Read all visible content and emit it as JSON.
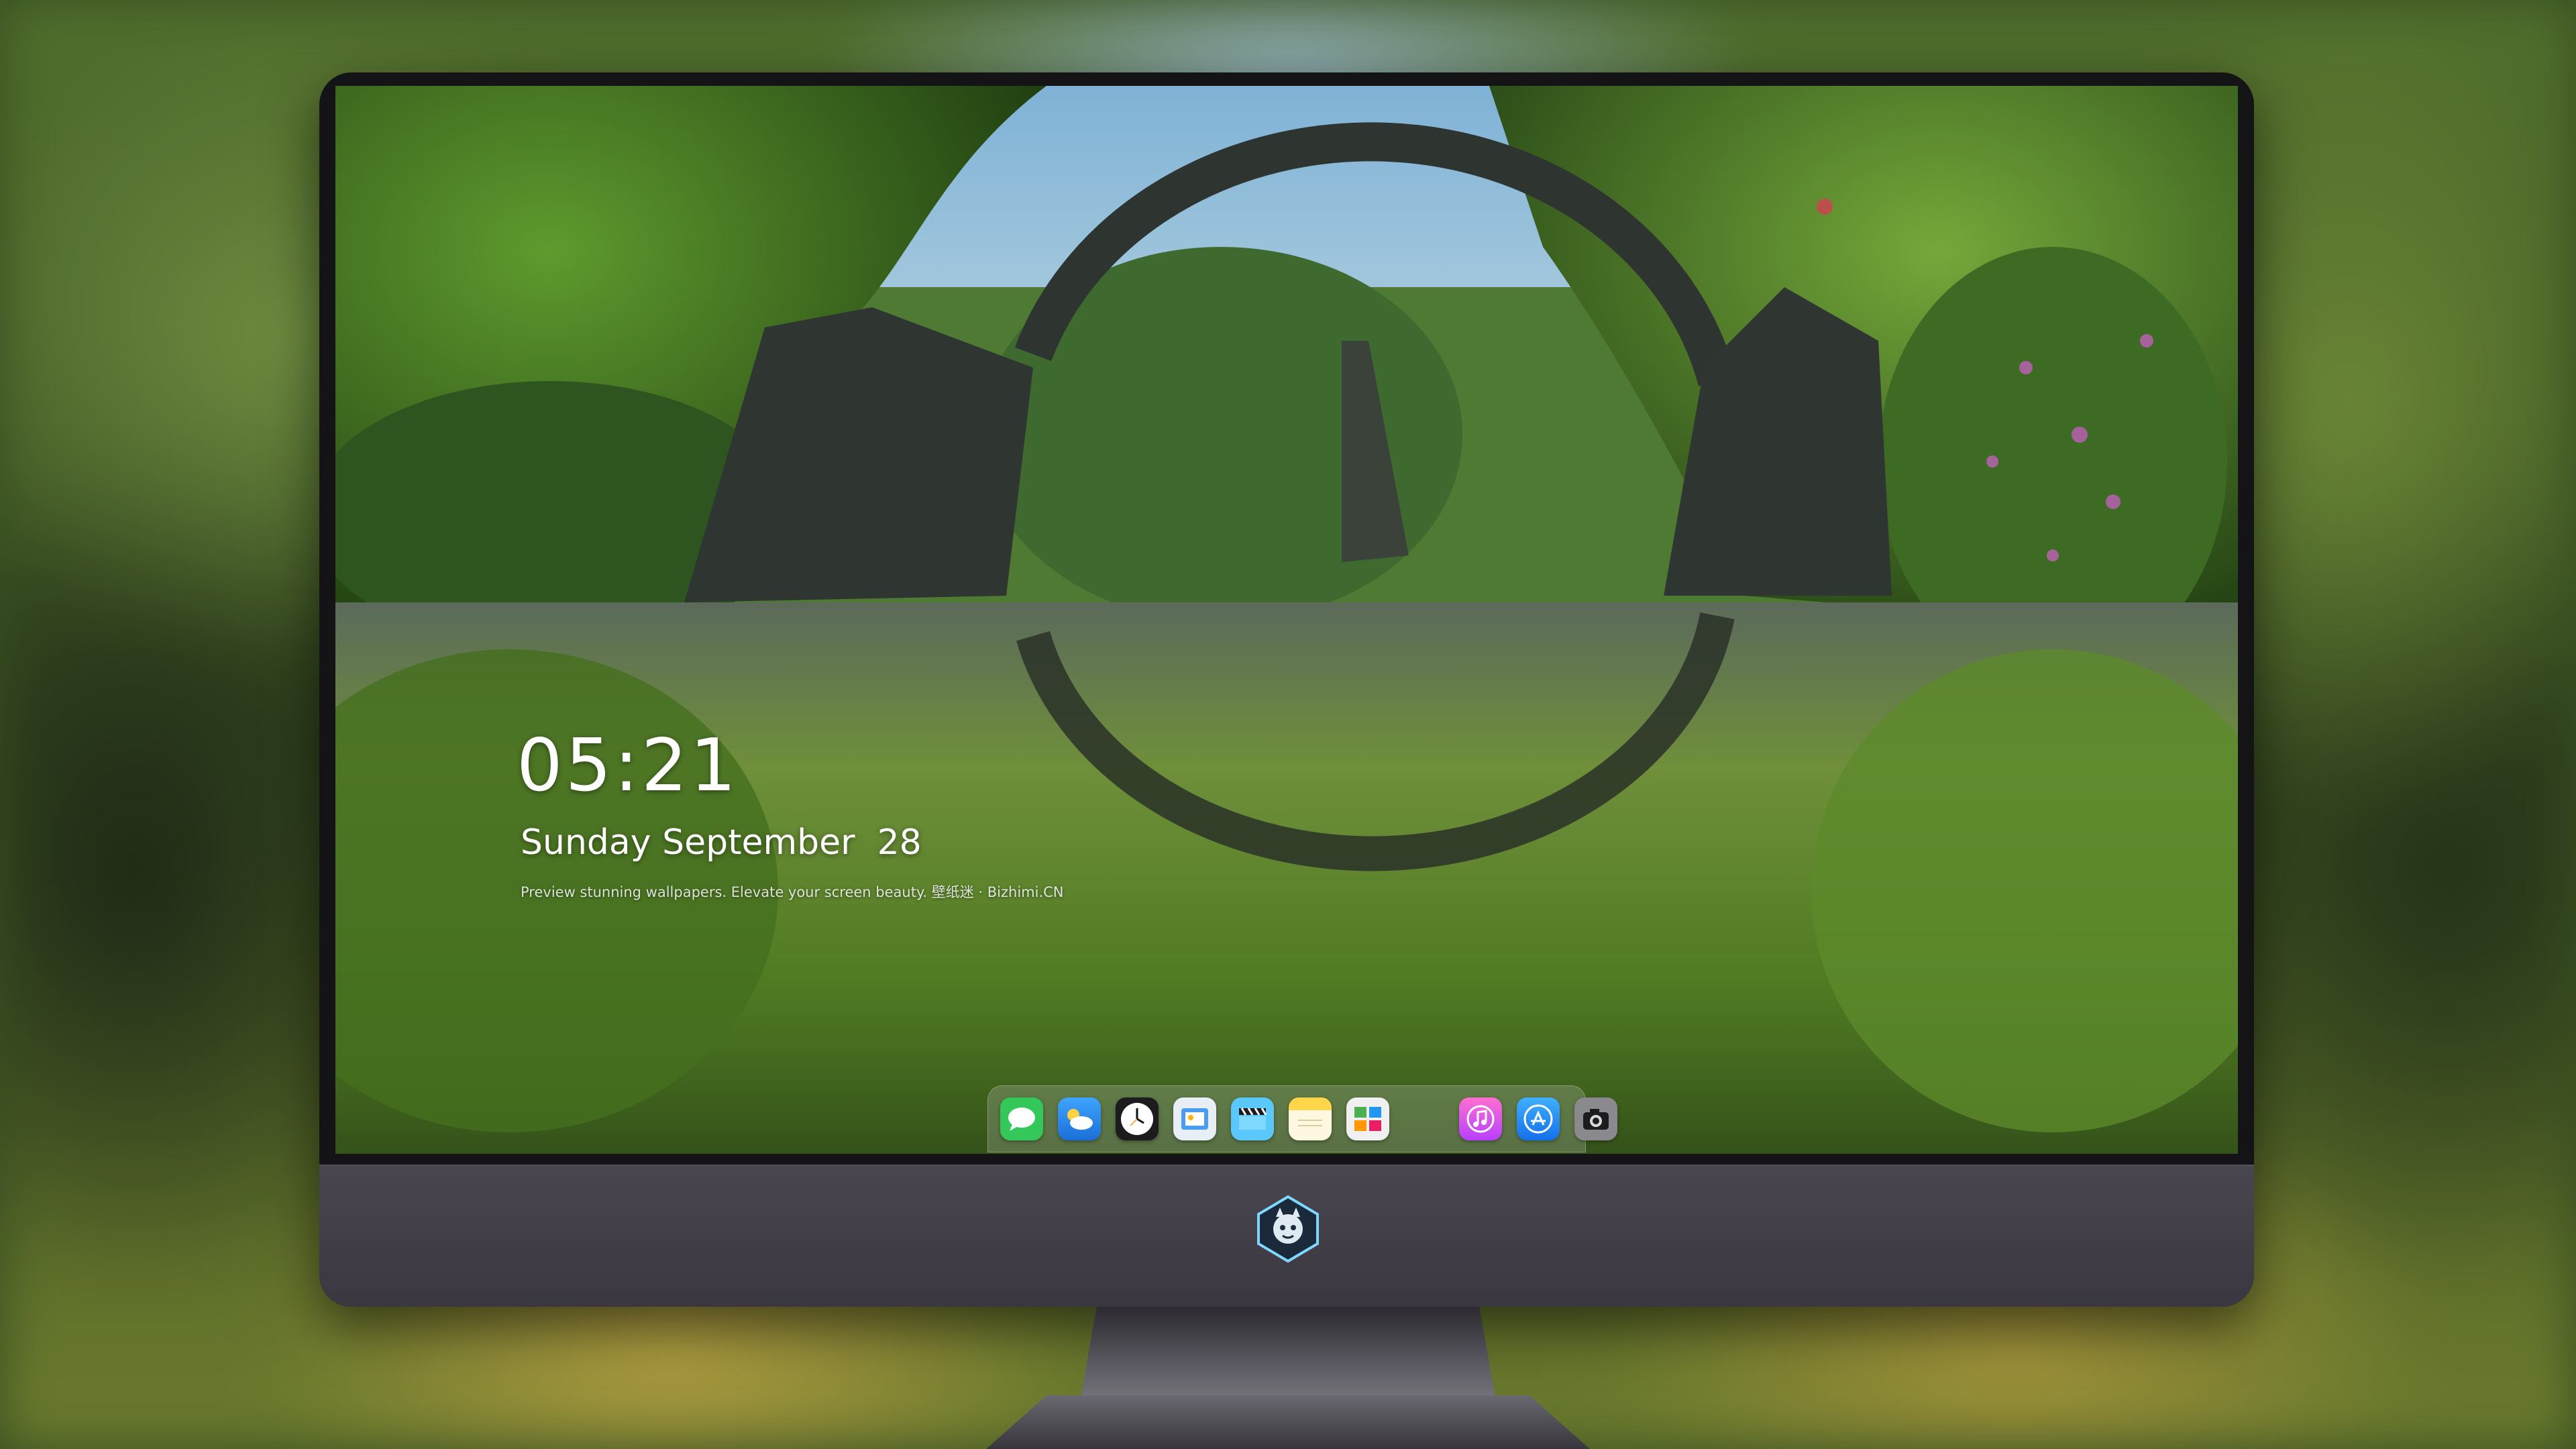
{
  "lock_screen": {
    "time": "05:21",
    "date": "Sunday September  28",
    "caption": "Preview stunning wallpapers. Elevate your screen beauty. 壁纸迷 · Bizhimi.CN"
  },
  "dock": {
    "apps": [
      {
        "icon": "messages-icon",
        "color": "#34c759"
      },
      {
        "icon": "weather-icon",
        "color": "#2f8ff0"
      },
      {
        "icon": "clock-icon",
        "color": "#ffffff"
      },
      {
        "icon": "preview-icon",
        "color": "#e8eef6"
      },
      {
        "icon": "clips-icon",
        "color": "#5ac8fa"
      },
      {
        "icon": "notes-icon",
        "color": "#ffd54a"
      },
      {
        "icon": "photo-booth-icon",
        "color": "#f0f0f0"
      },
      {
        "icon": "music-icon",
        "color": "#ff4fa8"
      },
      {
        "icon": "app-store-icon",
        "color": "#1a8cff"
      },
      {
        "icon": "camera-icon",
        "color": "#8a8a8e"
      }
    ]
  },
  "monitor": {
    "logo": "bizhimi-logo"
  }
}
